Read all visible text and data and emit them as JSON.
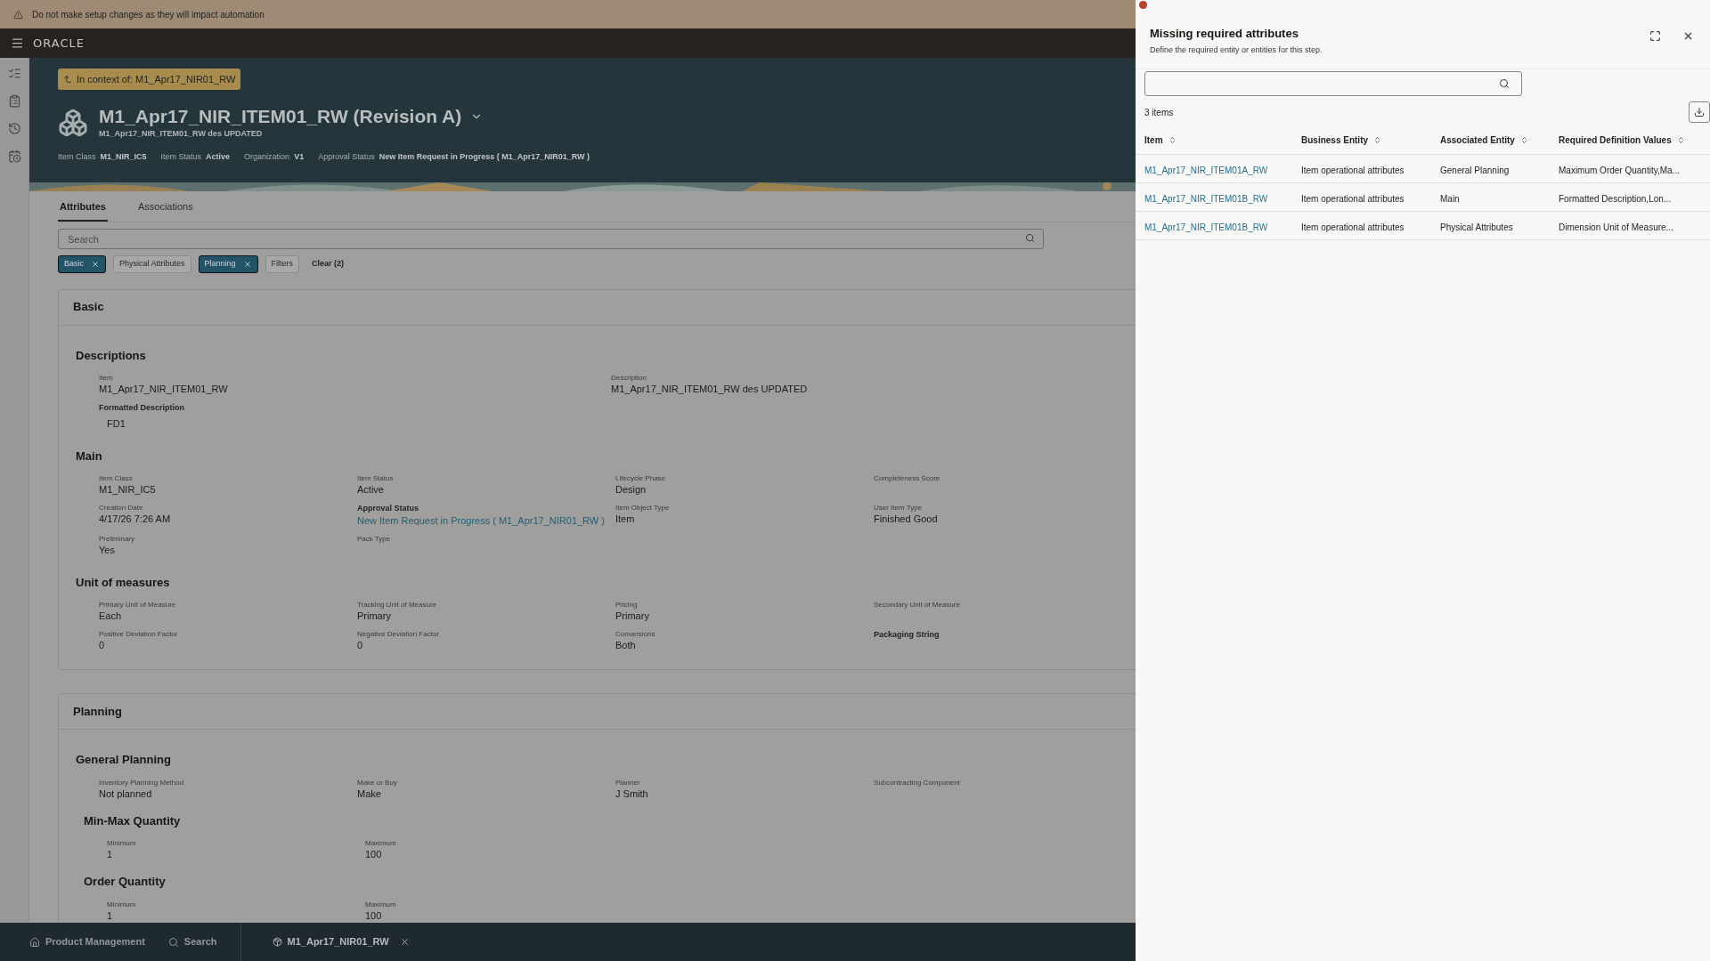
{
  "banner": {
    "text": "Do not make setup changes as they will impact automation"
  },
  "brand": {
    "logo": "ORACLE"
  },
  "context_badge": {
    "text": "In context of: M1_Apr17_NIR01_RW"
  },
  "item": {
    "title": "M1_Apr17_NIR_ITEM01_RW (Revision A)",
    "subtitle": "M1_Apr17_NIR_ITEM01_RW des UPDATED",
    "meta": [
      {
        "label": "Item Class",
        "value": "M1_NIR_IC5"
      },
      {
        "label": "Item Status",
        "value": "Active"
      },
      {
        "label": "Organization",
        "value": "V1"
      },
      {
        "label": "Approval Status",
        "value": "New Item Request in Progress ( M1_Apr17_NIR01_RW )"
      }
    ]
  },
  "tabs": [
    {
      "label": "Attributes",
      "selected": true
    },
    {
      "label": "Associations",
      "selected": false
    }
  ],
  "search": {
    "placeholder": "Search"
  },
  "filter_chips": [
    {
      "label": "Basic",
      "selected": true
    },
    {
      "label": "Physical Attributes",
      "selected": false
    },
    {
      "label": "Planning",
      "selected": true
    },
    {
      "label": "Filters",
      "selected": false
    }
  ],
  "clear_link": "Clear (2)",
  "sections": [
    {
      "title": "Basic",
      "groups": [
        {
          "title": "Descriptions",
          "kind": "wide",
          "rows": [
            [
              {
                "label": "Item",
                "value": "M1_Apr17_NIR_ITEM01_RW"
              },
              {
                "label": "Description",
                "value": "M1_Apr17_NIR_ITEM01_RW des UPDATED"
              }
            ],
            [
              {
                "label": "Formatted Description",
                "strong": true,
                "value": "FD1",
                "indented": true
              }
            ]
          ]
        },
        {
          "title": "Main",
          "kind": "normal",
          "rows": [
            [
              {
                "label": "Item Class",
                "value": "M1_NIR_IC5"
              },
              {
                "label": "Item Status",
                "value": "Active"
              },
              {
                "label": "Lifecycle Phase",
                "value": "Design"
              },
              {
                "label": "Completeness Score"
              }
            ],
            [
              {
                "label": "Creation Date",
                "value": "4/17/26 7:26 AM"
              },
              {
                "label": "Approval Status",
                "strong": true,
                "value": "New Item Request in Progress ( M1_Apr17_NIR01_RW )",
                "link": true
              },
              {
                "label": "Item Object Type",
                "value": "Item"
              },
              {
                "label": "User Item Type",
                "value": "Finished Good"
              }
            ],
            [
              {
                "label": "Preliminary",
                "value": "Yes"
              },
              {
                "label": "Pack Type"
              }
            ]
          ]
        },
        {
          "title": "Unit of measures",
          "kind": "normal",
          "rows": [
            [
              {
                "label": "Primary Unit of Measure",
                "value": "Each"
              },
              {
                "label": "Tracking Unit of Measure",
                "value": "Primary"
              },
              {
                "label": "Pricing",
                "value": "Primary"
              },
              {
                "label": "Secondary Unit of Measure"
              }
            ],
            [
              {
                "label": "Positive Deviation Factor",
                "value": "0"
              },
              {
                "label": "Negative Deviation Factor",
                "value": "0"
              },
              {
                "label": "Conversions",
                "value": "Both"
              },
              {
                "label": "Packaging String",
                "strong": true
              }
            ]
          ]
        }
      ]
    },
    {
      "title": "Planning",
      "groups": [
        {
          "title": "General Planning",
          "kind": "normal",
          "rows": [
            [
              {
                "label": "Inventory Planning Method",
                "value": "Not planned"
              },
              {
                "label": "Make or Buy",
                "value": "Make"
              },
              {
                "label": "Planner",
                "value": "J Smith"
              },
              {
                "label": "Subcontracting Component"
              }
            ]
          ],
          "children": [
            {
              "title": "Min-Max Quantity",
              "kind": "normal",
              "rows": [
                [
                  {
                    "label": "Minimum",
                    "value": "1"
                  },
                  {
                    "label": "Maximum",
                    "value": "100"
                  }
                ]
              ]
            },
            {
              "title": "Order Quantity",
              "kind": "normal",
              "rows": [
                [
                  {
                    "label": "Minimum",
                    "value": "1"
                  },
                  {
                    "label": "Maximum",
                    "value": "100"
                  }
                ]
              ]
            }
          ]
        }
      ]
    }
  ],
  "taskbar": {
    "items": [
      {
        "kind": "home",
        "label": "Product Management"
      },
      {
        "kind": "search",
        "label": "Search"
      }
    ],
    "tab": {
      "label": "M1_Apr17_NIR01_RW"
    }
  },
  "drawer": {
    "title": "Missing required attributes",
    "subtitle": "Define the required entity or entities for this step.",
    "count": "3 items",
    "columns": [
      "Item",
      "Business Entity",
      "Associated Entity",
      "Required Definition Values"
    ],
    "rows": [
      [
        "M1_Apr17_NIR_ITEM01A_RW",
        "Item operational attributes",
        "General Planning",
        "Maximum Order Quantity,Ma..."
      ],
      [
        "M1_Apr17_NIR_ITEM01B_RW",
        "Item operational attributes",
        "Main",
        "Formatted Description,Lon..."
      ],
      [
        "M1_Apr17_NIR_ITEM01B_RW",
        "Item operational attributes",
        "Physical Attributes",
        "Dimension Unit of Measure..."
      ]
    ]
  }
}
